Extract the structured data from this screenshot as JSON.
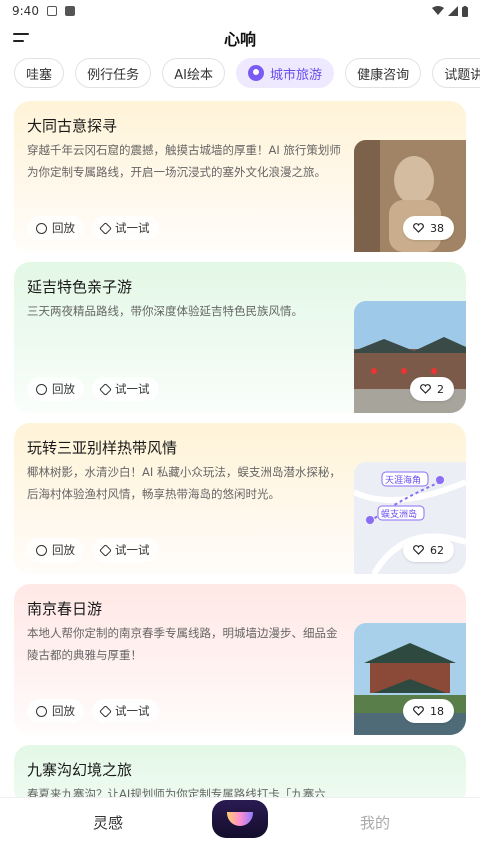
{
  "status": {
    "time": "9:40"
  },
  "header": {
    "title": "心响"
  },
  "tabs": [
    {
      "label": "哇塞"
    },
    {
      "label": "例行任务"
    },
    {
      "label": "AI绘本"
    },
    {
      "label": "城市旅游",
      "active": true
    },
    {
      "label": "健康咨询"
    },
    {
      "label": "试题讲解"
    }
  ],
  "actions": {
    "replay": "回放",
    "try": "试一试"
  },
  "cards": [
    {
      "title": "大同古意探寻",
      "desc": "穿越千年云冈石窟的震撼，触摸古城墙的厚重！AI 旅行策划师为你定制专属路线，开启一场沉浸式的塞外文化浪漫之旅。",
      "likes": "38"
    },
    {
      "title": "延吉特色亲子游",
      "desc": "三天两夜精品路线，带你深度体验延吉特色民族风情。",
      "likes": "2"
    },
    {
      "title": "玩转三亚别样热带风情",
      "desc": "椰林树影，水清沙白！AI 私藏小众玩法，蜈支洲岛潜水探秘，后海村体验渔村风情，畅享热带海岛的悠闲时光。",
      "likes": "62",
      "map_labels": [
        "天涯海角",
        "蜈支洲岛"
      ]
    },
    {
      "title": "南京春日游",
      "desc": "本地人帮你定制的南京春季专属线路，明城墙边漫步、细品金陵古都的典雅与厚重！",
      "likes": "18"
    },
    {
      "title": "九寨沟幻境之旅",
      "desc": "春夏来九寨沟？让AI规划师为你定制专属路线打卡「九寨六"
    }
  ],
  "bottom_nav": {
    "left": "灵感",
    "right": "我的"
  },
  "colors": {
    "accent": "#6a4df0"
  }
}
